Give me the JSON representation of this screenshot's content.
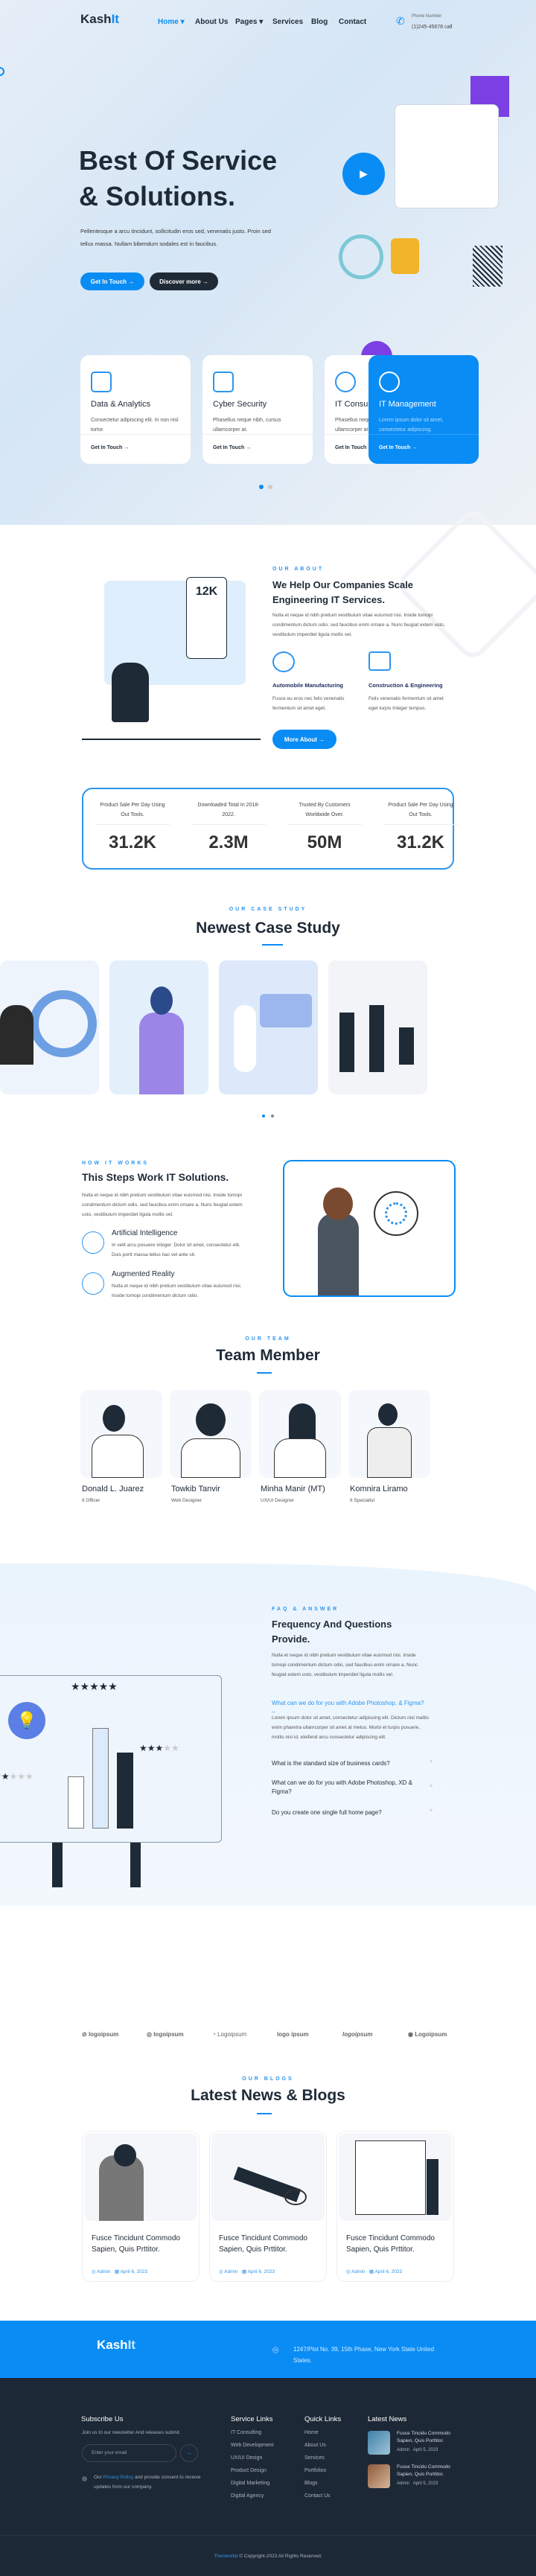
{
  "brand": {
    "name": "Kash",
    "suffix": "It",
    "accent": "#0a8cf5",
    "dark": "#1f2a37"
  },
  "nav": {
    "items": [
      "Home",
      "About Us",
      "Pages",
      "Services",
      "Blog",
      "Contact"
    ],
    "phone_label": "Phone Number",
    "phone": "(1)245-45678 call"
  },
  "hero": {
    "title_line1": "Best Of Service",
    "title_line2": "& Solutions.",
    "text": "Pellentesque a arcu tincidunt, sollicitudin eros sed, venenatis justo. Proin sed tellus massa. Nullam bibendum sodales est in faucibus.",
    "btn_primary": "Get In Touch →",
    "btn_secondary": "Discover more →"
  },
  "services": [
    {
      "title": "Data & Analytics",
      "text": "Consectetur adipiscing elit. In non nisl tortor.",
      "link": "Get In Touch →"
    },
    {
      "title": "Cyber Security",
      "text": "Phasellus neque nibh, cursus ullamcorper at.",
      "link": "Get In Touch →"
    },
    {
      "title": "IT Consultancy",
      "text": "Phasellus neque nibh, cursus ullamcorper at.",
      "link": "Get In Touch →"
    },
    {
      "title": "IT Management",
      "text": "Lorem ipsum dolor sit amet, consectetur adipiscing.",
      "link": "Get In Touch →"
    }
  ],
  "about": {
    "eyebrow": "OUR ABOUT",
    "title": "We Help Our Companies Scale Engineering IT Services.",
    "text": "Nulla et neque id nibh pretium vestibulum vitae euismod nisi. Inside tomopi condimentum dictum odio, sed faucibus enim ornare a. Nunc feugiat extem usto, vestibulum imperdiet ligula mollis vel.",
    "features": [
      {
        "title": "Automobile Manufacturing",
        "text": "Fusce eu eros nec felis venenatis fermentum sit amet eget."
      },
      {
        "title": "Construction & Engineering",
        "text": "Felis venenatis fermentum sit amet eget turpis Integer tempus."
      }
    ],
    "button": "More About →",
    "illustration_text": "12K"
  },
  "stats": [
    {
      "label": "Product Sale Per Day Using Out Tools.",
      "value": "31.2K"
    },
    {
      "label": "Downloaded Total In 2018-2022.",
      "value": "2.3M"
    },
    {
      "label": "Trusted By Customers Worldwide Over.",
      "value": "50M"
    },
    {
      "label": "Product Sale Per Day Using Out Tools.",
      "value": "31.2K"
    }
  ],
  "case_study": {
    "eyebrow": "OUR CASE STUDY",
    "title": "Newest Case Study"
  },
  "how": {
    "eyebrow": "HOW IT WORKS",
    "title": "This Steps Work IT Solutions.",
    "text": "Nulla et neque id nibh pretium vestibulum vitae euismod nisi. Inside tomopi condimentum dictum odio, sed faucibus enim ornare a. Nunc feugiat extem usto, vestibulum imperdiet ligula mollis vel.",
    "items": [
      {
        "title": "Artificial Intelligence",
        "text": "In velit arcu posuere integer. Dolor sit amet, consectetur elit. Duis portt massa tellus hac vel ante sit."
      },
      {
        "title": "Augmented Reality",
        "text": "Nulla et neque id nibh pretium vestibulum vitae euismod nisi. Inside tomopi condimentum dictum odio."
      }
    ]
  },
  "team": {
    "eyebrow": "OUR TEAM",
    "title": "Team Member",
    "members": [
      {
        "name": "Donald L. Juarez",
        "role": "It Officer"
      },
      {
        "name": "Towkib Tanvir",
        "role": "Web Designer"
      },
      {
        "name": "Minha Manir (MT)",
        "role": "UX/UI Designer"
      },
      {
        "name": "Komnira Liramo",
        "role": "It Specialist"
      }
    ]
  },
  "faq": {
    "eyebrow": "FAQ & ANSWER",
    "title": "Frequency And Questions Provide.",
    "text": "Nulla et neque id nibh pretium vestibulum vitae euismod nisi. Inside tomopi condimentum dictum odio, sed faucibus enim ornare a. Nunc feugiat extem usto, vestibulum imperdiet ligula mollis vel.",
    "items": [
      {
        "q": "What can we do for you with Adobe Photoshop, & Figma?",
        "a": "Lorem ipsum dolor sit amet, consectetur adipiscing elit. Dictum nisl mattis enim pharetra ullamcorper sit amet at metus. Morbi et turpis posuere, mollis nisi id, eleifend arcu consectetur adipiscing elit.",
        "open": true
      },
      {
        "q": "What is the standard size of business cards?"
      },
      {
        "q": "What can we do for you with Adobe Photoshop, XD & Figma?"
      },
      {
        "q": "Do you create one single full home page?"
      }
    ]
  },
  "logos": [
    "logoipsum",
    "logoipsum",
    "Logoipsum",
    "logo ipsum",
    "logoipsum",
    "Logoipsum"
  ],
  "blogs": {
    "eyebrow": "OUR BLOGS",
    "title": "Latest News & Blogs",
    "posts": [
      {
        "title": "Fusce Tincidunt Commodo Sapien, Quis Prttitor.",
        "author": "Admin",
        "date": "April 6, 2023"
      },
      {
        "title": "Fusce Tincidunt Commodo Sapien, Quis Prttitor.",
        "author": "Admin",
        "date": "April 6, 2023"
      },
      {
        "title": "Fusce Tincidunt Commodo Sapien, Quis Prttitor.",
        "author": "Admin",
        "date": "April 6, 2023"
      }
    ]
  },
  "footer": {
    "address": "1247/Plot No. 39, 15th Phase, New York State United States.",
    "subscribe_title": "Subscribe Us",
    "subscribe_text": "Join us to our newsletter And releases submit.",
    "email_placeholder": "Enter your email",
    "privacy_pre": "Our",
    "privacy_link": "Privacy Policy",
    "privacy_post": "and provide consent to receive updates from our company.",
    "service_title": "Service Links",
    "service_links": [
      "IT Consulting",
      "Web Development",
      "UX/UI Design",
      "Product Design",
      "Digital Marketing",
      "Digital Agency"
    ],
    "quick_title": "Quick Links",
    "quick_links": [
      "Home",
      "About Us",
      "Services",
      "Portfolios",
      "Blogs",
      "Contact Us"
    ],
    "news_title": "Latest News",
    "news": [
      {
        "title": "Fusce Tincidu Commodo Sapien, Quis Porttitor.",
        "author": "Admin",
        "date": "April 5, 2023"
      },
      {
        "title": "Fusce Tincidu Commodo Sapien, Quis Porttitor.",
        "author": "Admin",
        "date": "April 5, 2023"
      }
    ],
    "copyright_brand": "Themesflat",
    "copyright": "© Copyright-2023 All Rights Reserved."
  }
}
